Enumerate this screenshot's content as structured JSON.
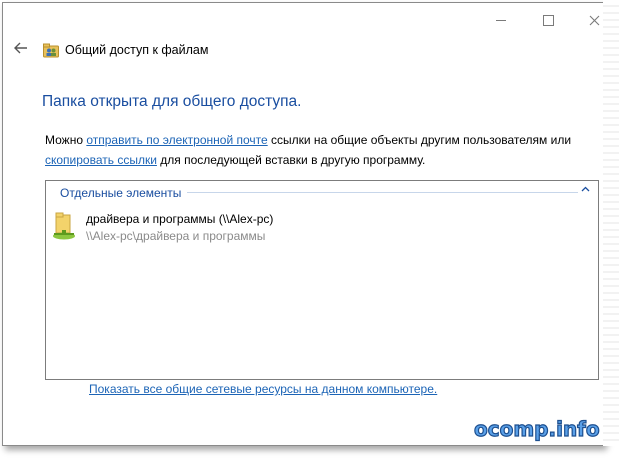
{
  "window": {
    "title": "Общий доступ к файлам"
  },
  "main": {
    "heading": "Папка открыта для общего доступа.",
    "desc_prefix": "Можно ",
    "desc_link1": "отправить по электронной почте",
    "desc_middle": " ссылки на общие объекты другим пользователям или ",
    "desc_link2": "скопировать ссылки",
    "desc_suffix": " для последующей вставки в другую программу."
  },
  "list": {
    "group_label": "Отдельные элементы",
    "items": [
      {
        "name": "драйвера и программы (\\\\Alex-pc)",
        "path": "\\\\Alex-pc\\драйвера и программы",
        "icon": "shared-folder-icon"
      }
    ]
  },
  "footer": {
    "link": "Показать все общие сетевые ресурсы на данном компьютере."
  },
  "watermark": {
    "text": "ocomp.info"
  },
  "colors": {
    "heading": "#1a4ea0",
    "link": "#1c64b6",
    "path": "#8a8a8a"
  }
}
